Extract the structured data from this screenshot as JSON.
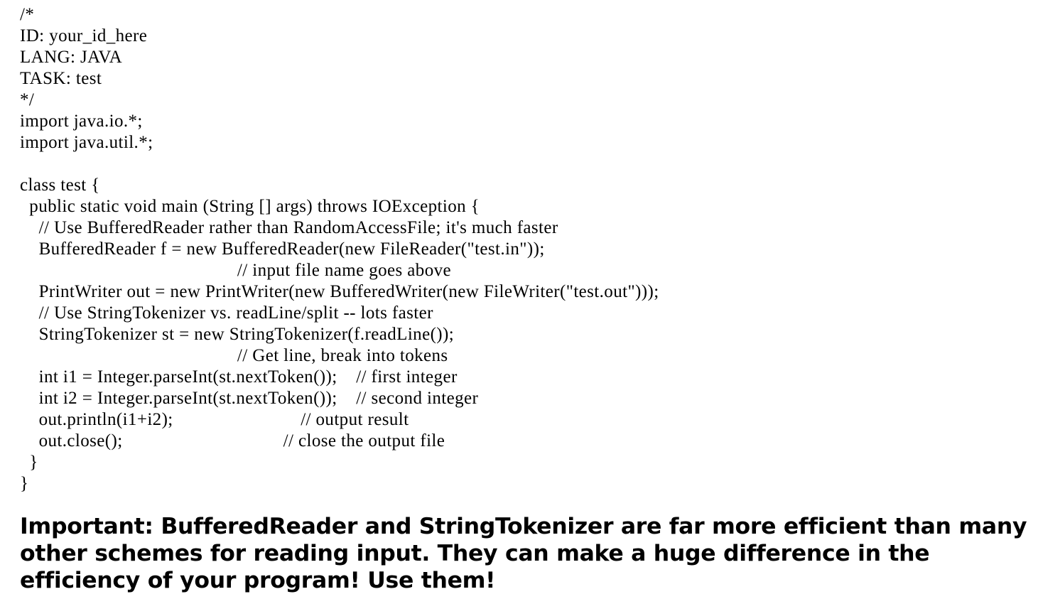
{
  "code": {
    "lines": [
      "/*",
      "ID: your_id_here",
      "LANG: JAVA",
      "TASK: test",
      "*/",
      "import java.io.*;",
      "import java.util.*;",
      "",
      "class test {",
      "  public static void main (String [] args) throws IOException {",
      "    // Use BufferedReader rather than RandomAccessFile; it's much faster",
      "    BufferedReader f = new BufferedReader(new FileReader(\"test.in\"));",
      "                                              // input file name goes above",
      "    PrintWriter out = new PrintWriter(new BufferedWriter(new FileWriter(\"test.out\")));",
      "    // Use StringTokenizer vs. readLine/split -- lots faster",
      "    StringTokenizer st = new StringTokenizer(f.readLine());",
      "                                              // Get line, break into tokens",
      "    int i1 = Integer.parseInt(st.nextToken());    // first integer",
      "    int i2 = Integer.parseInt(st.nextToken());    // second integer",
      "    out.println(i1+i2);                           // output result",
      "    out.close();                                  // close the output file",
      "  }",
      "}"
    ]
  },
  "note": {
    "text": "Important: BufferedReader and StringTokenizer are far more efficient than many other schemes for reading input. They can make a huge difference in the efficiency of your program! Use them!"
  }
}
